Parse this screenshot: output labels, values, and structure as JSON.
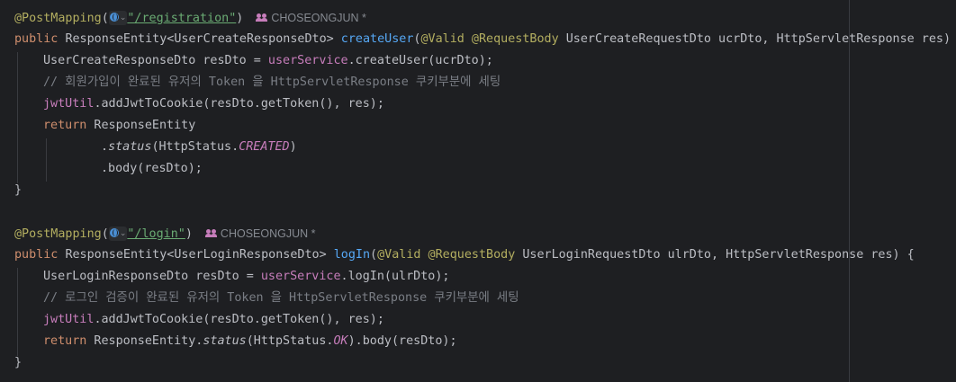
{
  "method1": {
    "annotation": "@PostMapping",
    "path": "\"/registration\"",
    "author": "CHOSEONGJUN *",
    "signature": {
      "modifier": "public",
      "return_type": "ResponseEntity<UserCreateResponseDto>",
      "name": "createUser",
      "params_prefix": "(",
      "param_ann1": "@Valid",
      "param_ann2": "@RequestBody",
      "params_rest": " UserCreateRequestDto ucrDto, HttpServletResponse res) {"
    },
    "body": {
      "l1_type": "UserCreateResponseDto resDto = ",
      "l1_field": "userService",
      "l1_rest": ".createUser(ucrDto);",
      "l2_comment": "// 회원가입이 완료된 유저의 Token 을 HttpServletResponse 쿠키부분에 세팅",
      "l3_field": "jwtUtil",
      "l3_rest": ".addJwtToCookie(resDto.getToken(), res);",
      "l4_kw": "return",
      "l4_rest": " ResponseEntity",
      "l5_dot": ".",
      "l5_method": "status",
      "l5_open": "(HttpStatus.",
      "l5_const": "CREATED",
      "l5_close": ")",
      "l6": ".body(resDto);",
      "close": "}"
    }
  },
  "method2": {
    "annotation": "@PostMapping",
    "path": "\"/login\"",
    "author": "CHOSEONGJUN *",
    "signature": {
      "modifier": "public",
      "return_type": "ResponseEntity<UserLoginResponseDto>",
      "name": "logIn",
      "params_prefix": "(",
      "param_ann1": "@Valid",
      "param_ann2": "@RequestBody",
      "params_rest": " UserLoginRequestDto ulrDto, HttpServletResponse res) {"
    },
    "body": {
      "l1_type": "UserLoginResponseDto resDto = ",
      "l1_field": "userService",
      "l1_rest": ".logIn(ulrDto);",
      "l2_comment": "// 로그인 검증이 완료된 유저의 Token 을 HttpServletResponse 쿠키부분에 세팅",
      "l3_field": "jwtUtil",
      "l3_rest": ".addJwtToCookie(resDto.getToken(), res);",
      "l4_kw": "return",
      "l4_mid": " ResponseEntity.",
      "l4_method": "status",
      "l4_open": "(HttpStatus.",
      "l4_const": "OK",
      "l4_rest": ").body(resDto);",
      "close": "}"
    }
  },
  "colors": {
    "background": "#1e1f22",
    "annotation": "#b3ae60",
    "keyword": "#cf8e6d",
    "function": "#56a8f5",
    "string": "#6aab73",
    "field": "#c77dbb",
    "comment": "#7a7e85"
  },
  "icons": [
    "globe-icon",
    "chevron-down-icon",
    "people-icon"
  ]
}
